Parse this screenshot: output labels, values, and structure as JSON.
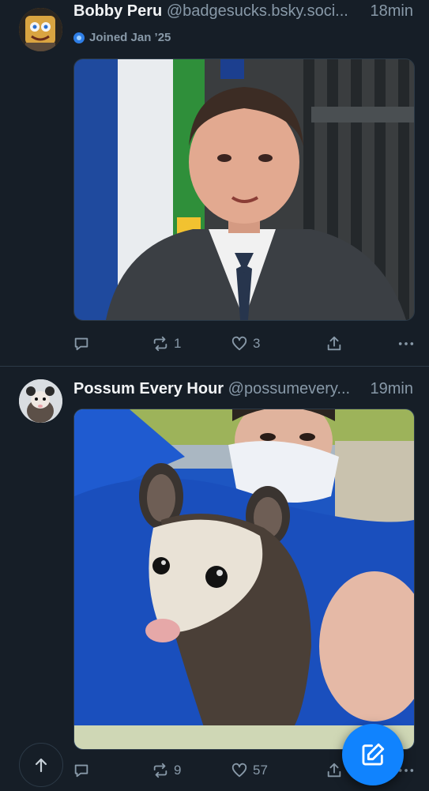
{
  "posts": [
    {
      "display_name": "Bobby Peru",
      "handle": "@badgesucks.bsky.soci...",
      "time": "18min",
      "joined": "Joined Jan ’25",
      "stats": {
        "reposts": "1",
        "likes": "3"
      }
    },
    {
      "display_name": "Possum Every Hour",
      "handle": "@possumevery...",
      "time": "19min",
      "stats": {
        "reposts": "9",
        "likes": "57"
      }
    }
  ],
  "icons": {
    "reply": "reply-icon",
    "repost": "repost-icon",
    "like": "heart-icon",
    "share": "share-icon",
    "more": "more-icon",
    "scroll_top": "arrow-up-icon",
    "compose": "compose-icon"
  },
  "colors": {
    "background": "#161e27",
    "muted_text": "#8899a8",
    "accent": "#1083fe",
    "divider": "#2c3a47"
  }
}
